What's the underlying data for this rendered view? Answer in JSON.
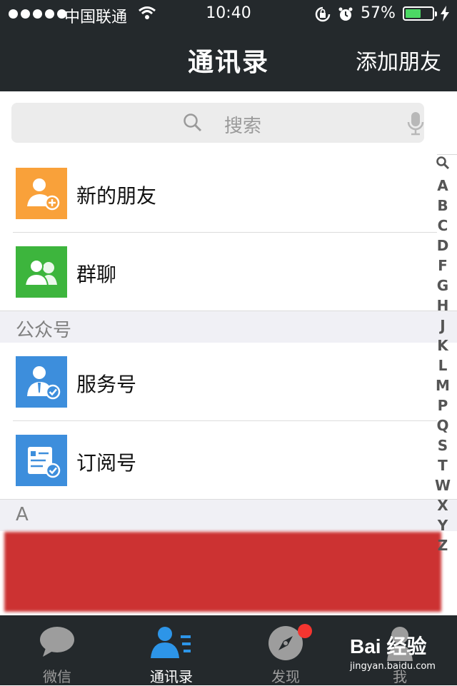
{
  "status_bar": {
    "carrier": "中国联通",
    "time": "10:40",
    "battery_percent": "57%",
    "battery_level": 0.57,
    "icons": [
      "signal-dots",
      "wifi-icon",
      "rotation-lock-icon",
      "alarm-icon",
      "battery-icon",
      "charging-icon"
    ]
  },
  "nav": {
    "title": "通讯录",
    "action_label": "添加朋友"
  },
  "search": {
    "placeholder": "搜索"
  },
  "list": {
    "top_items": [
      {
        "label": "新的朋友",
        "icon": "new-friend-icon",
        "color": "#f9a13a"
      },
      {
        "label": "群聊",
        "icon": "group-chat-icon",
        "color": "#3db53d"
      }
    ],
    "public_section": {
      "header": "公众号",
      "items": [
        {
          "label": "服务号",
          "icon": "service-account-icon",
          "color": "#3d8edc"
        },
        {
          "label": "订阅号",
          "icon": "subscription-account-icon",
          "color": "#3d8edc"
        }
      ]
    },
    "contacts_section": {
      "header": "A"
    }
  },
  "index_bar": {
    "search_icon": "search-icon",
    "letters": [
      "A",
      "B",
      "C",
      "D",
      "F",
      "G",
      "H",
      "J",
      "K",
      "L",
      "M",
      "P",
      "Q",
      "S",
      "T",
      "W",
      "X",
      "Y",
      "Z"
    ]
  },
  "tabbar": {
    "tabs": [
      {
        "label": "微信",
        "icon": "chat-bubble-icon",
        "active": false
      },
      {
        "label": "通讯录",
        "icon": "contacts-icon",
        "active": true
      },
      {
        "label": "发现",
        "icon": "compass-icon",
        "active": false,
        "badge": true
      },
      {
        "label": "我",
        "icon": "person-icon",
        "active": false
      }
    ]
  },
  "watermark": {
    "brand": "Bai 经验",
    "url": "jingyan.baidu.com"
  },
  "colors": {
    "header_bg": "#24292c",
    "accent_blue": "#3d8edc",
    "active_tab": "#2d95e8",
    "badge_red": "#f43530"
  }
}
